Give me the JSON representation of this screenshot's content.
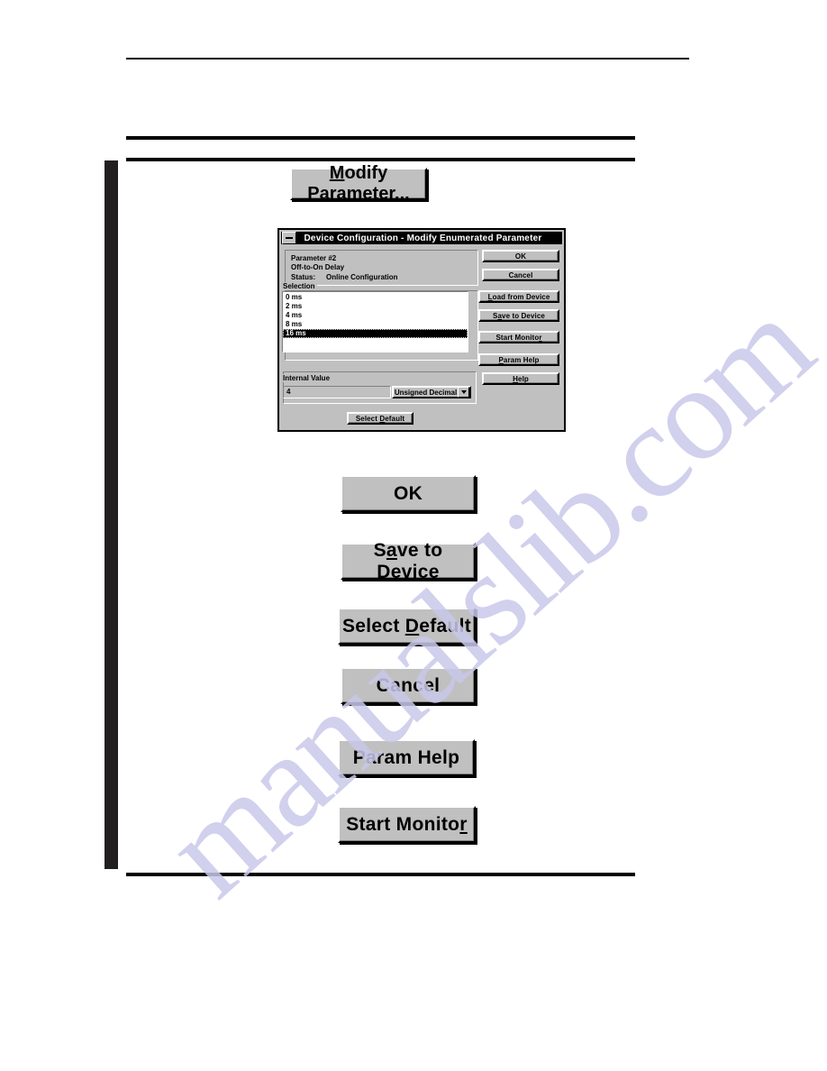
{
  "page": {
    "background_color": "#ffffff",
    "change_bar_color": "#231f20",
    "rule_color": "#000000",
    "watermark_text": "manualslib.com",
    "watermark_color": "#c9c8ea"
  },
  "sample_button": {
    "modify_parameter": {
      "label": "Modify Parameter...",
      "accel": "M"
    }
  },
  "dialog": {
    "title": "Device Configuration - Modify Enumerated Parameter",
    "minimize_icon": "minimize-icon",
    "info": {
      "parameter": "Parameter #2",
      "description": "Off-to-On Delay",
      "status_label": "Status:",
      "status_value": "Online Configuration"
    },
    "selection": {
      "legend": "Selection",
      "items": [
        "0 ms",
        "2 ms",
        "4 ms",
        "8 ms",
        "16 ms"
      ],
      "selected_index": 4
    },
    "internal_value": {
      "legend": "Internal Value",
      "value": "4",
      "format": "Unsigned Decimal",
      "dropdown_icon": "chevron-down-icon"
    },
    "buttons": {
      "ok": "OK",
      "cancel": "Cancel",
      "load_from_device": "Load from Device",
      "load_from_device_accel": "L",
      "save_to_device": "Save to Device",
      "save_to_device_accel": "a",
      "start_monitor": "Start Monitor",
      "start_monitor_accel": "r",
      "param_help": "Param Help",
      "param_help_accel": "P",
      "help": "Help",
      "help_accel": "H",
      "select_default": "Select Default",
      "select_default_accel": "D"
    }
  },
  "callout_buttons": [
    {
      "id": "ok",
      "label": "OK",
      "accel": ""
    },
    {
      "id": "save-to-device",
      "label": "Save to Device",
      "accel": "a"
    },
    {
      "id": "select-default",
      "label": "Select Default",
      "accel": "D"
    },
    {
      "id": "cancel",
      "label": "Cancel",
      "accel": ""
    },
    {
      "id": "param-help",
      "label": "Param Help",
      "accel": ""
    },
    {
      "id": "start-monitor",
      "label": "Start Monitor",
      "accel": "r"
    }
  ]
}
